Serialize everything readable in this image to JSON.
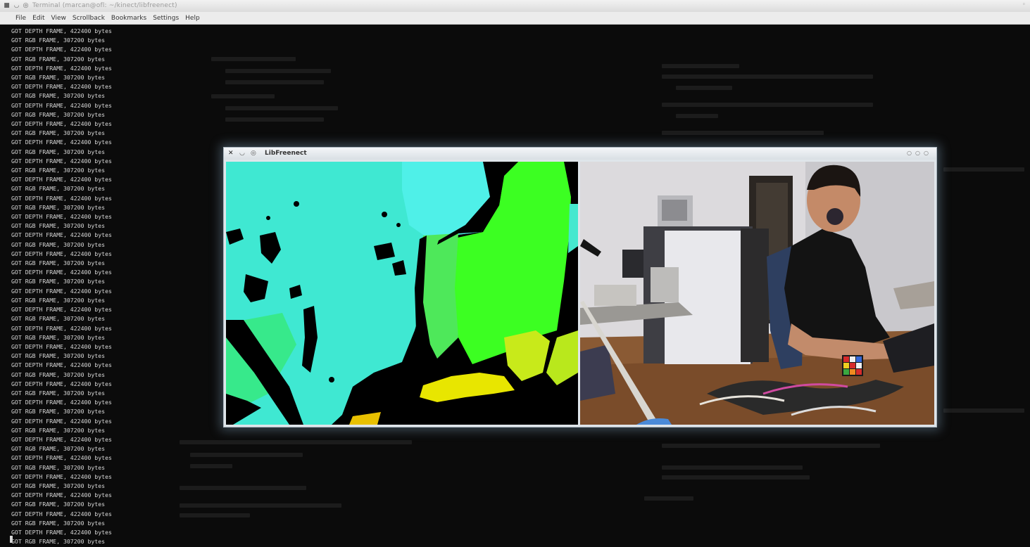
{
  "window": {
    "title": "Terminal (marcan@ofl: ~/kinect/libfreenect)",
    "menu": [
      "File",
      "Edit",
      "View",
      "Scrollback",
      "Bookmarks",
      "Settings",
      "Help"
    ]
  },
  "terminal": {
    "depth_line": "GOT DEPTH FRAME, 422400 bytes",
    "rgb_line": "GOT RGB FRAME, 307200 bytes",
    "line_count": 56
  },
  "viewer": {
    "title": "LibFreenect",
    "depth_view": "depth-camera-feed",
    "rgb_view": "rgb-camera-feed"
  },
  "colors": {
    "terminal_bg": "#0b0b0b",
    "terminal_text": "#d7d7d7",
    "depth_cyan": "#3fe8d2",
    "depth_green": "#3cff22",
    "depth_yellow": "#e8e600"
  }
}
